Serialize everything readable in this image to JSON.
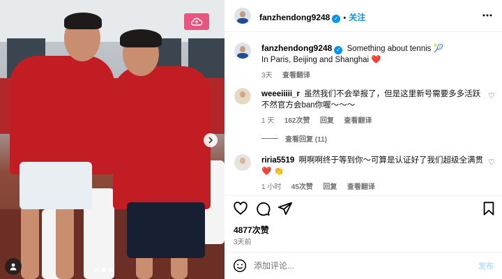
{
  "photo": {
    "description_icons": {
      "cloud": "cloud-upload-icon",
      "next": "chevron-right-icon",
      "user_tag": "user-tag-icon"
    },
    "carousel_count": 3,
    "carousel_active": 1
  },
  "header": {
    "username": "fanzhendong9248",
    "verified_icon": "verified-badge-icon",
    "separator": "•",
    "follow_label": "关注",
    "more_icon": "more-horizontal-icon"
  },
  "caption": {
    "username": "fanzhendong9248",
    "line1": "Something about tennis 🎾",
    "line2": "In Paris, Beijing and Shanghai ❤️",
    "time": "3天",
    "translate": "查看翻译"
  },
  "comments": [
    {
      "username": "weeeiiiii_r",
      "text": "虽然我们不会举报了，但是这里新号需要多多活跃不然官方会ban你喔～～～",
      "time": "1 天",
      "likes": "162次赞",
      "reply": "回复",
      "translate": "查看翻译",
      "view_replies": "查看回复 (11)"
    },
    {
      "username": "riria5519",
      "text": "啊啊啊终于等到你～可算是认证好了我们超级全满贯 ❤️ 👏",
      "time": "1 小时",
      "likes": "45次赞",
      "reply": "回复",
      "translate": "查看翻译"
    }
  ],
  "actions": {
    "like_icon": "heart-icon",
    "comment_icon": "comment-icon",
    "share_icon": "share-icon",
    "save_icon": "bookmark-icon"
  },
  "stats": {
    "likes": "4877次赞",
    "date": "3天前"
  },
  "comment_box": {
    "emoji_icon": "emoji-icon",
    "placeholder": "添加评论...",
    "post_label": "发布"
  },
  "colors": {
    "accent": "#0095f6",
    "muted": "#737373",
    "jacket_red": "#c11d22",
    "cloud_button": "#e8557e"
  }
}
